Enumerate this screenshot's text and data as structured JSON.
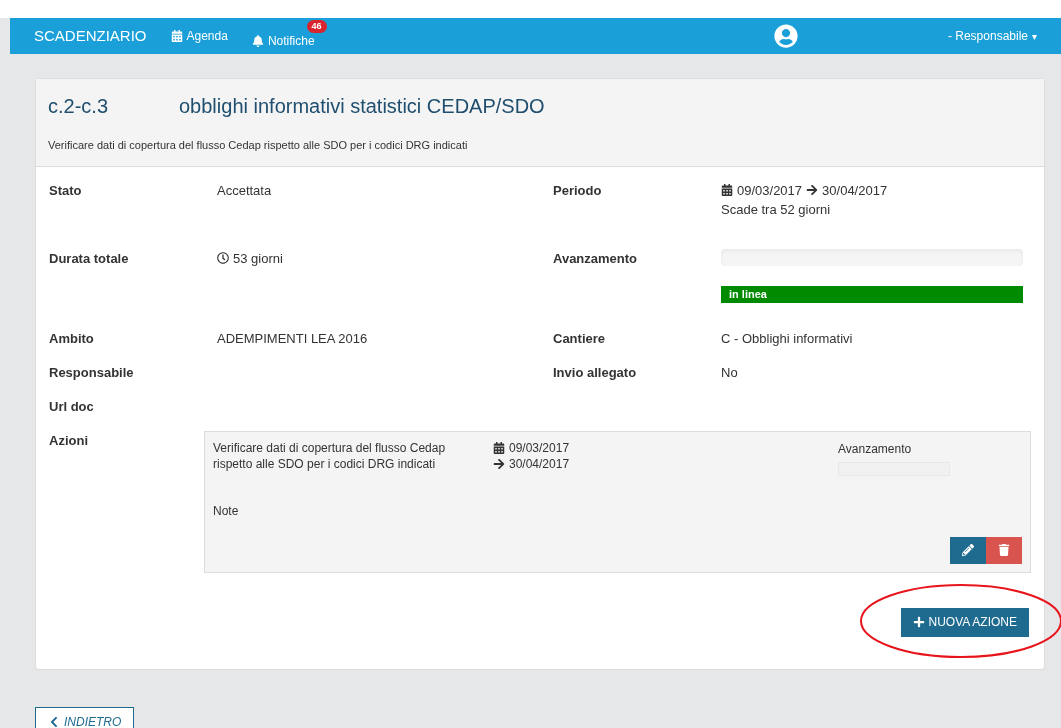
{
  "header": {
    "brand": "SCADENZIARIO",
    "nav": [
      {
        "label": "Agenda",
        "kind": "calendar"
      },
      {
        "label": "Notifiche",
        "kind": "bell",
        "badge": "46"
      }
    ],
    "user_menu": "- Responsabile",
    "user_menu_caret": "▾"
  },
  "title": {
    "code": "c.2-c.3",
    "name": "obblighi informativi statistici CEDAP/SDO"
  },
  "description": "Verificare dati di copertura del flusso Cedap rispetto alle SDO per i codici DRG indicati",
  "fields": [
    {
      "label": "Stato",
      "kind": "text",
      "value": "Accettata"
    },
    {
      "label": "Periodo",
      "kind": "period",
      "start": "09/03/2017",
      "end": "30/04/2017",
      "note": "Scade tra 52 giorni"
    },
    {
      "label": "Durata totale",
      "kind": "duration",
      "value": "53 giorni"
    },
    {
      "label": "Avanzamento",
      "kind": "progress",
      "level": 0,
      "status": "in linea"
    },
    {
      "label": "Ambito",
      "kind": "text",
      "value": "ADEMPIMENTI LEA 2016"
    },
    {
      "label": "Cantiere",
      "kind": "text",
      "value": "C - Obblighi informativi"
    },
    {
      "label": "Responsabile",
      "kind": "text"
    },
    {
      "label": "Invio allegato",
      "kind": "text",
      "value": "No"
    },
    {
      "label": "Url doc",
      "kind": "text"
    }
  ],
  "actions": {
    "label": "Azioni",
    "items": [
      {
        "text": "Verificare dati di copertura del flusso Cedap rispetto alle SDO per i codici DRG indicati",
        "start": "09/03/2017",
        "end": "30/04/2017",
        "progress_label": "Avanzamento",
        "level": 0,
        "note_label": "Note"
      }
    ]
  },
  "new_action_button": "NUOVA AZIONE",
  "back_button": "INDIETRO",
  "annotation": {
    "circled": true
  }
}
